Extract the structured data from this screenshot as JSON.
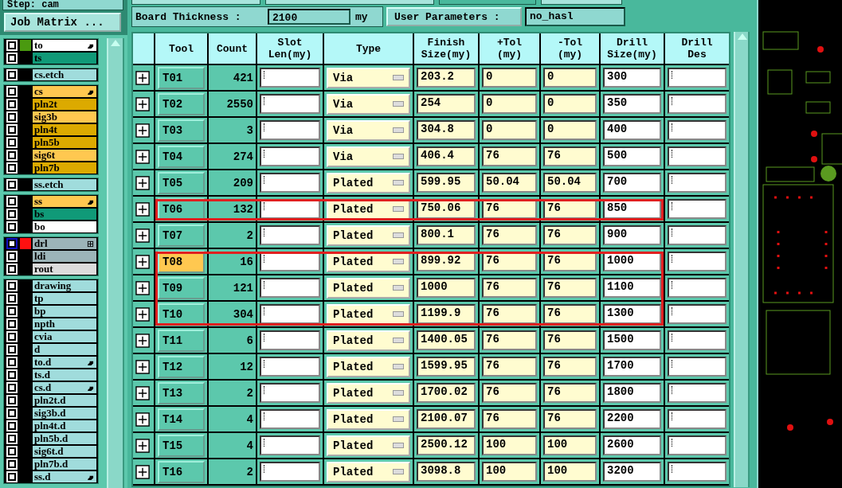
{
  "step": {
    "label": "Step: cam"
  },
  "job_matrix_button": "Job Matrix ...",
  "layer_groups": [
    {
      "layers": [
        {
          "name": "to",
          "color": "#ffffff",
          "swatch": {
            "color": "#4a9a10"
          },
          "pointer": true,
          "checked": false,
          "focused": false
        },
        {
          "name": "ts",
          "color": "#109a78",
          "checked": false,
          "pointer": false,
          "focused": false
        }
      ]
    },
    {
      "layers": [
        {
          "name": "cs.etch",
          "color": "#a0dcdc",
          "checked": false,
          "pointer": false,
          "focused": false
        }
      ]
    },
    {
      "layers": [
        {
          "name": "cs",
          "color": "#ffc850",
          "pointer": true,
          "checked": false,
          "focused": false
        },
        {
          "name": "pln2t",
          "color": "#dcaa00",
          "checked": false,
          "pointer": false,
          "focused": false
        },
        {
          "name": "sig3b",
          "color": "#ffc850",
          "checked": false,
          "pointer": false,
          "focused": false
        },
        {
          "name": "pln4t",
          "color": "#dcaa00",
          "checked": false,
          "pointer": false,
          "focused": false
        },
        {
          "name": "pln5b",
          "color": "#dcaa00",
          "checked": false,
          "pointer": false,
          "focused": false
        },
        {
          "name": "sig6t",
          "color": "#ffc850",
          "checked": false,
          "pointer": false,
          "focused": false
        },
        {
          "name": "pln7b",
          "color": "#dcaa00",
          "checked": false,
          "pointer": false,
          "focused": false
        }
      ]
    },
    {
      "layers": [
        {
          "name": "ss.etch",
          "color": "#a0dcdc",
          "checked": false,
          "pointer": false,
          "focused": false
        }
      ]
    },
    {
      "layers": [
        {
          "name": "ss",
          "color": "#ffc850",
          "pointer": true,
          "checked": false,
          "focused": false
        },
        {
          "name": "bs",
          "color": "#109a78",
          "checked": false,
          "pointer": false,
          "focused": false
        },
        {
          "name": "bo",
          "color": "#ffffff",
          "checked": false,
          "pointer": false,
          "focused": false
        }
      ]
    },
    {
      "layers": [
        {
          "name": "drl",
          "color": "#9cb4b8",
          "swatch": {
            "color": "#ff1010"
          },
          "expand_icon": true,
          "checked": false,
          "pointer": false,
          "focused": true
        },
        {
          "name": "ldi",
          "color": "#9cb4b8",
          "checked": false,
          "pointer": false,
          "focused": false
        },
        {
          "name": "rout",
          "color": "#dcdcdc",
          "checked": false,
          "pointer": false,
          "focused": false
        }
      ]
    },
    {
      "layers": [
        {
          "name": "drawing",
          "color": "#a0dcdc",
          "checked": false,
          "pointer": false,
          "focused": false
        },
        {
          "name": "tp",
          "color": "#a0dcdc",
          "checked": false,
          "pointer": false,
          "focused": false
        },
        {
          "name": "bp",
          "color": "#a0dcdc",
          "checked": false,
          "pointer": false,
          "focused": false
        },
        {
          "name": "npth",
          "color": "#a0dcdc",
          "checked": false,
          "pointer": false,
          "focused": false
        },
        {
          "name": "cvia",
          "color": "#a0dcdc",
          "checked": false,
          "pointer": false,
          "focused": false
        },
        {
          "name": "d",
          "color": "#a0dcdc",
          "checked": false,
          "pointer": false,
          "focused": false
        },
        {
          "name": "to.d",
          "color": "#a0dcdc",
          "pointer": true,
          "checked": false,
          "focused": false
        },
        {
          "name": "ts.d",
          "color": "#a0dcdc",
          "checked": false,
          "pointer": false,
          "focused": false
        },
        {
          "name": "cs.d",
          "color": "#a0dcdc",
          "pointer": true,
          "checked": false,
          "focused": false
        },
        {
          "name": "pln2t.d",
          "color": "#a0dcdc",
          "checked": false,
          "pointer": false,
          "focused": false
        },
        {
          "name": "sig3b.d",
          "color": "#a0dcdc",
          "checked": false,
          "pointer": false,
          "focused": false
        },
        {
          "name": "pln4t.d",
          "color": "#a0dcdc",
          "checked": false,
          "pointer": false,
          "focused": false
        },
        {
          "name": "pln5b.d",
          "color": "#a0dcdc",
          "checked": false,
          "pointer": false,
          "focused": false
        },
        {
          "name": "sig6t.d",
          "color": "#a0dcdc",
          "checked": false,
          "pointer": false,
          "focused": false
        },
        {
          "name": "pln7b.d",
          "color": "#a0dcdc",
          "checked": false,
          "pointer": false,
          "focused": false
        },
        {
          "name": "ss.d",
          "color": "#a0dcdc",
          "pointer": true,
          "checked": false,
          "focused": false
        }
      ]
    }
  ],
  "board_thickness": {
    "label": "Board Thickness :",
    "value": "2100",
    "unit": "my"
  },
  "user_parameters": {
    "label": "User Parameters :",
    "value": "no_hasl"
  },
  "table": {
    "columns": [
      "Tool",
      "Count",
      "Slot\nLen(my)",
      "Type",
      "Finish\nSize(my)",
      "+Tol\n(my)",
      "-Tol\n(my)",
      "Drill\nSize(my)",
      "Drill\nDes"
    ],
    "rows": [
      {
        "tool": "T01",
        "count": "421",
        "type": "Via",
        "finish": "203.2",
        "plus_tol": "0",
        "minus_tol": "0",
        "drill": "300",
        "selected": false,
        "marked": false
      },
      {
        "tool": "T02",
        "count": "2550",
        "type": "Via",
        "finish": "254",
        "plus_tol": "0",
        "minus_tol": "0",
        "drill": "350",
        "selected": false,
        "marked": false
      },
      {
        "tool": "T03",
        "count": "3",
        "type": "Via",
        "finish": "304.8",
        "plus_tol": "0",
        "minus_tol": "0",
        "drill": "400",
        "selected": false,
        "marked": false
      },
      {
        "tool": "T04",
        "count": "274",
        "type": "Via",
        "finish": "406.4",
        "plus_tol": "76",
        "minus_tol": "76",
        "drill": "500",
        "selected": false,
        "marked": false
      },
      {
        "tool": "T05",
        "count": "209",
        "type": "Plated",
        "finish": "599.95",
        "plus_tol": "50.04",
        "minus_tol": "50.04",
        "drill": "700",
        "selected": false,
        "marked": false
      },
      {
        "tool": "T06",
        "count": "132",
        "type": "Plated",
        "finish": "750.06",
        "plus_tol": "76",
        "minus_tol": "76",
        "drill": "850",
        "selected": false,
        "marked": true
      },
      {
        "tool": "T07",
        "count": "2",
        "type": "Plated",
        "finish": "800.1",
        "plus_tol": "76",
        "minus_tol": "76",
        "drill": "900",
        "selected": false,
        "marked": false
      },
      {
        "tool": "T08",
        "count": "16",
        "type": "Plated",
        "finish": "899.92",
        "plus_tol": "76",
        "minus_tol": "76",
        "drill": "1000",
        "selected": true,
        "marked": true
      },
      {
        "tool": "T09",
        "count": "121",
        "type": "Plated",
        "finish": "1000",
        "plus_tol": "76",
        "minus_tol": "76",
        "drill": "1100",
        "selected": false,
        "marked": true
      },
      {
        "tool": "T10",
        "count": "304",
        "type": "Plated",
        "finish": "1199.9",
        "plus_tol": "76",
        "minus_tol": "76",
        "drill": "1300",
        "selected": false,
        "marked": true
      },
      {
        "tool": "T11",
        "count": "6",
        "type": "Plated",
        "finish": "1400.05",
        "plus_tol": "76",
        "minus_tol": "76",
        "drill": "1500",
        "selected": false,
        "marked": false
      },
      {
        "tool": "T12",
        "count": "12",
        "type": "Plated",
        "finish": "1599.95",
        "plus_tol": "76",
        "minus_tol": "76",
        "drill": "1700",
        "selected": false,
        "marked": false
      },
      {
        "tool": "T13",
        "count": "2",
        "type": "Plated",
        "finish": "1700.02",
        "plus_tol": "76",
        "minus_tol": "76",
        "drill": "1800",
        "selected": false,
        "marked": false
      },
      {
        "tool": "T14",
        "count": "4",
        "type": "Plated",
        "finish": "2100.07",
        "plus_tol": "76",
        "minus_tol": "76",
        "drill": "2200",
        "selected": false,
        "marked": false
      },
      {
        "tool": "T15",
        "count": "4",
        "type": "Plated",
        "finish": "2500.12",
        "plus_tol": "100",
        "minus_tol": "100",
        "drill": "2600",
        "selected": false,
        "marked": false
      },
      {
        "tool": "T16",
        "count": "2",
        "type": "Plated",
        "finish": "3098.8",
        "plus_tol": "100",
        "minus_tol": "100",
        "drill": "3200",
        "selected": false,
        "marked": false
      }
    ]
  }
}
